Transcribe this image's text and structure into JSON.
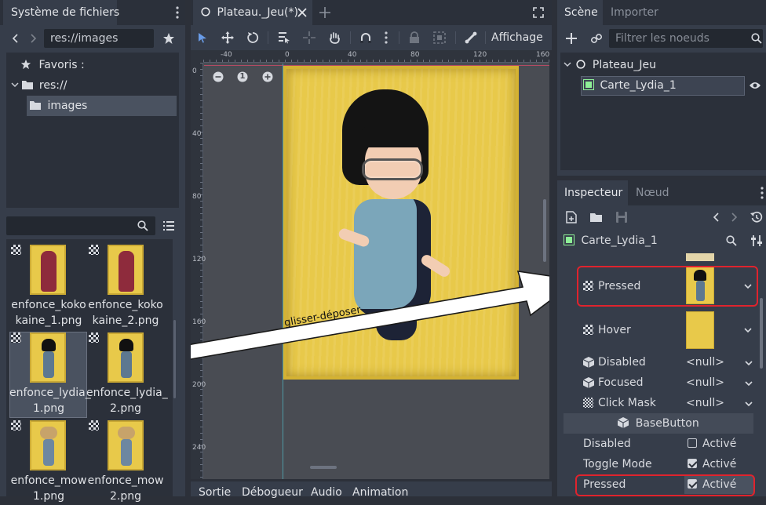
{
  "filesystem": {
    "tab_label": "Système de fichiers",
    "path_value": "res://images",
    "favorites_label": "Favoris :",
    "root_label": "res://",
    "folder_label": "images",
    "files": [
      {
        "name_line1": "enfonce_koko",
        "name_line2": "kaine_1.png"
      },
      {
        "name_line1": "enfonce_koko",
        "name_line2": "kaine_2.png"
      },
      {
        "name_line1": "enfonce_lydia_",
        "name_line2": "1.png"
      },
      {
        "name_line1": "enfonce_lydia_",
        "name_line2": "2.png"
      },
      {
        "name_line1": "enfonce_mow",
        "name_line2": "1.png"
      },
      {
        "name_line1": "enfonce_mow",
        "name_line2": "2.png"
      }
    ]
  },
  "editor": {
    "tab_label": "Plateau._Jeu(*)",
    "view_menu": "Affichage",
    "zoom_reset": "1",
    "ruler_top": [
      "-40",
      "0",
      "40",
      "80",
      "120",
      "160"
    ],
    "ruler_left": [
      "0",
      "40",
      "80",
      "120",
      "160",
      "200",
      "240"
    ],
    "annotation": "glisser-déposer"
  },
  "bottom_tabs": [
    "Sortie",
    "Débogueur",
    "Audio",
    "Animation"
  ],
  "scene": {
    "tab_scene": "Scène",
    "tab_import": "Importer",
    "filter_placeholder": "Filtrer les noeuds",
    "root_node": "Plateau_Jeu",
    "child_node": "Carte_Lydia_1"
  },
  "inspector": {
    "tab_inspector": "Inspecteur",
    "tab_node": "Nœud",
    "object_name": "Carte_Lydia_1",
    "texture_props": [
      {
        "label": "Pressed"
      },
      {
        "label": "Hover"
      }
    ],
    "null_props": [
      {
        "label": "Disabled",
        "value": "<null>"
      },
      {
        "label": "Focused",
        "value": "<null>"
      },
      {
        "label": "Click Mask",
        "value": "<null>"
      }
    ],
    "section": "BaseButton",
    "bool_props": [
      {
        "label": "Disabled",
        "value": "Activé",
        "checked": false
      },
      {
        "label": "Toggle Mode",
        "value": "Activé",
        "checked": true
      },
      {
        "label": "Pressed",
        "value": "Activé",
        "checked": true
      }
    ]
  },
  "colors": {
    "accent": "#699ce8",
    "highlight": "#e0232d",
    "card": "#e8c94a"
  }
}
